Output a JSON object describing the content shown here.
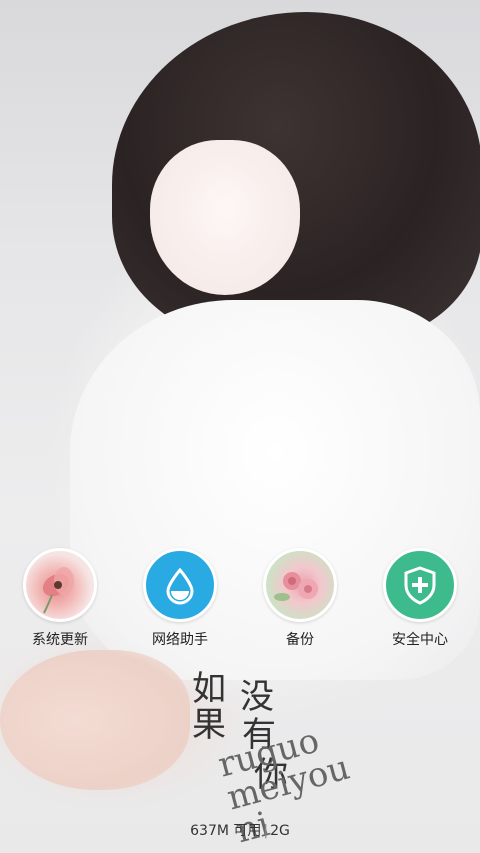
{
  "dock": {
    "items": [
      {
        "label": "系统更新",
        "icon": "flower-photo-icon"
      },
      {
        "label": "网络助手",
        "icon": "water-drop-icon"
      },
      {
        "label": "备份",
        "icon": "roses-photo-icon"
      },
      {
        "label": "安全中心",
        "icon": "shield-plus-icon"
      }
    ]
  },
  "wallpaper_title": {
    "chars": [
      "如",
      "没",
      "果",
      "有",
      "你"
    ],
    "stamp": "ruguo meiyou ni"
  },
  "status": {
    "memory": "637M 可用",
    "network": "2G"
  },
  "colors": {
    "drop_icon_bg": "#29aae2",
    "shield_icon_bg": "#3dbb8d",
    "label_text": "#222222"
  }
}
